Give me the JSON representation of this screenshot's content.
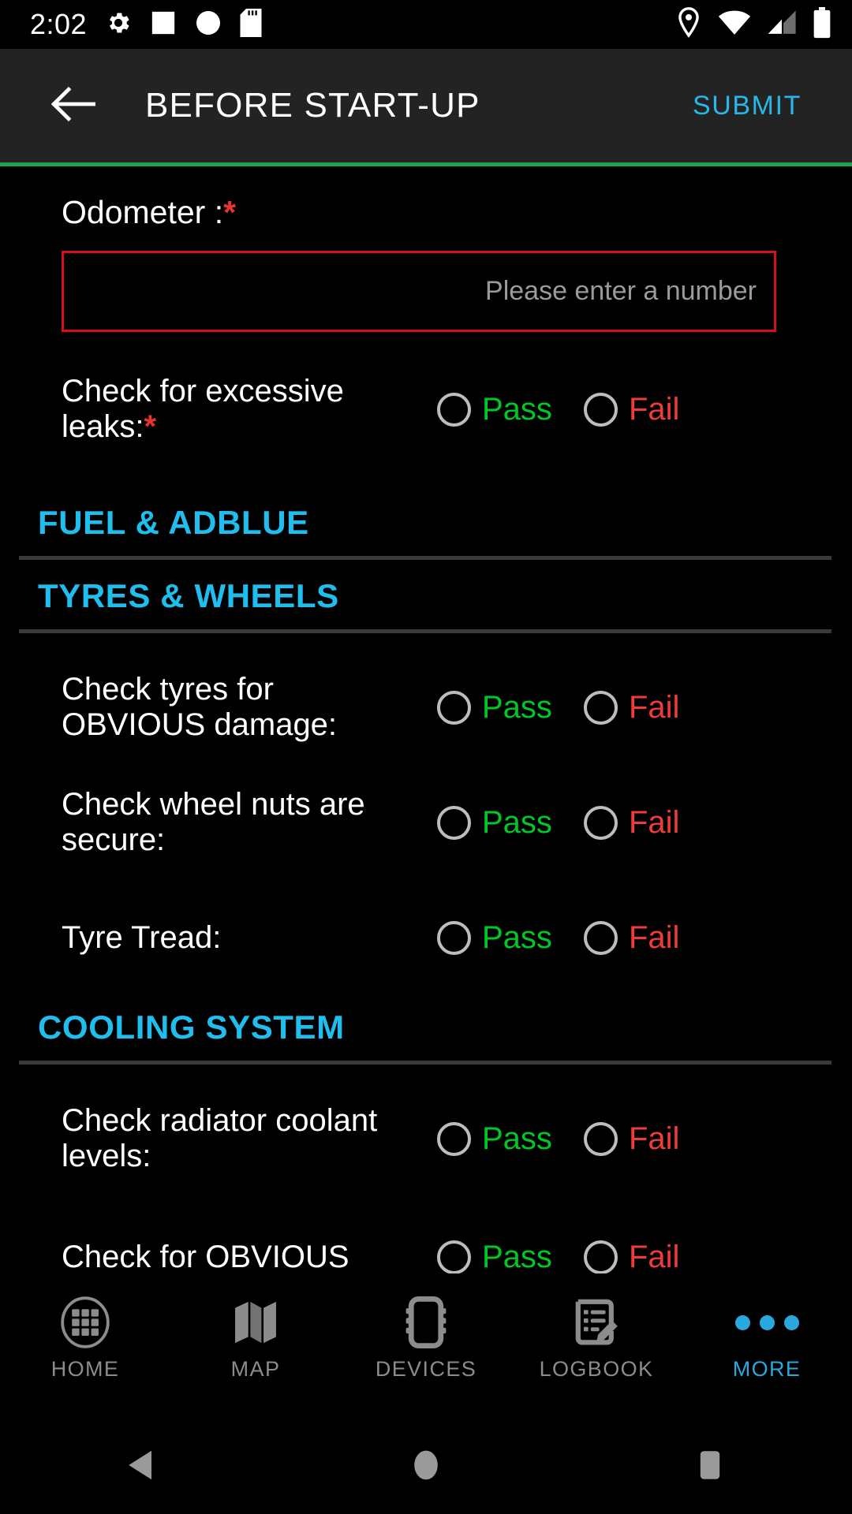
{
  "statusbar": {
    "time": "2:02",
    "left_icons": [
      "settings-gear-icon",
      "white-square-icon",
      "white-circle-icon",
      "sd-card-icon"
    ],
    "right_icons": [
      "location-pin-icon",
      "wifi-icon",
      "cellular-signal-icon",
      "battery-icon"
    ]
  },
  "appbar": {
    "back_icon": "back-arrow-icon",
    "title": "BEFORE START-UP",
    "submit_label": "SUBMIT",
    "submit_color": "#29B6E8",
    "background": "#232323",
    "accent_rule_color": "#1EA34E"
  },
  "form": {
    "odometer": {
      "label": "Odometer :",
      "required_mark": "*",
      "value": "",
      "placeholder": "Please enter a number",
      "border_color": "#D80F17"
    },
    "option_labels": {
      "pass": "Pass",
      "fail": "Fail"
    },
    "option_colors": {
      "pass": "#00C728",
      "fail": "#F03B3B",
      "radio": "#BDBDBD"
    },
    "items": [
      {
        "label": "Check for excessive leaks:",
        "required_mark": "*",
        "selected": ""
      }
    ],
    "sections": [
      {
        "title": "FUEL & ADBLUE",
        "items": []
      },
      {
        "title": "TYRES & WHEELS",
        "items": [
          {
            "label": "Check tyres for OBVIOUS damage:",
            "required_mark": "",
            "selected": ""
          },
          {
            "label": "Check wheel nuts are secure:",
            "required_mark": "",
            "selected": ""
          },
          {
            "label": "Tyre Tread:",
            "required_mark": "",
            "selected": ""
          }
        ]
      },
      {
        "title": "COOLING SYSTEM",
        "items": [
          {
            "label": "Check radiator coolant levels:",
            "required_mark": "",
            "selected": ""
          },
          {
            "label": "Check for OBVIOUS",
            "required_mark": "",
            "selected": ""
          }
        ]
      }
    ],
    "section_title_color": "#1FBEEE"
  },
  "bottomnav": {
    "items": [
      {
        "label": "HOME",
        "icon": "home-grid-icon",
        "active": false
      },
      {
        "label": "MAP",
        "icon": "map-icon",
        "active": false
      },
      {
        "label": "DEVICES",
        "icon": "device-icon",
        "active": false
      },
      {
        "label": "LOGBOOK",
        "icon": "logbook-pencil-icon",
        "active": false
      },
      {
        "label": "MORE",
        "icon": "more-dots-icon",
        "active": true
      }
    ],
    "active_color": "#29A8E0",
    "inactive_color": "#8c8c8c"
  },
  "androidnav": {
    "back": "android-back-icon",
    "home": "android-home-icon",
    "recents": "android-recents-icon"
  }
}
